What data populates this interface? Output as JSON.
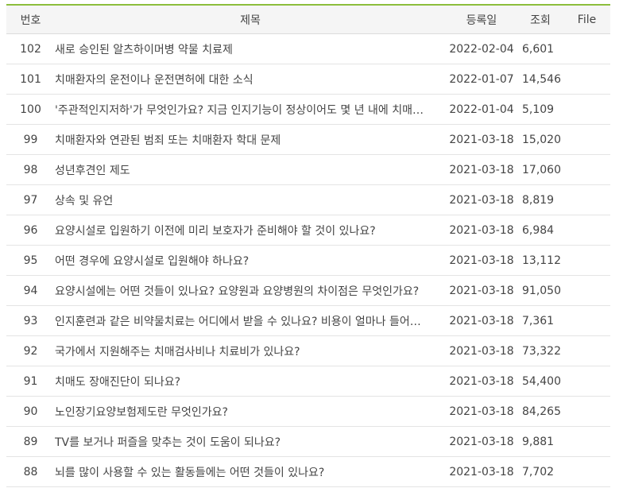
{
  "columns": {
    "number": "번호",
    "title": "제목",
    "date": "등록일",
    "views": "조회",
    "file": "File"
  },
  "rows": [
    {
      "number": "102",
      "title": "새로 승인된 알츠하이머병 약물 치료제",
      "date": "2022-02-04",
      "views": "6,601"
    },
    {
      "number": "101",
      "title": "치매환자의 운전이나 운전면허에 대한 소식",
      "date": "2022-01-07",
      "views": "14,546"
    },
    {
      "number": "100",
      "title": "'주관적인지저하'가 무엇인가요? 지금 인지기능이 정상이어도 몇 년 내에 치매…",
      "date": "2022-01-04",
      "views": "5,109"
    },
    {
      "number": "99",
      "title": "치매환자와 연관된 범죄 또는 치매환자 학대 문제",
      "date": "2021-03-18",
      "views": "15,020"
    },
    {
      "number": "98",
      "title": "성년후견인 제도",
      "date": "2021-03-18",
      "views": "17,060"
    },
    {
      "number": "97",
      "title": "상속 및 유언",
      "date": "2021-03-18",
      "views": "8,819"
    },
    {
      "number": "96",
      "title": "요양시설로 입원하기 이전에 미리 보호자가 준비해야 할 것이 있나요?",
      "date": "2021-03-18",
      "views": "6,984"
    },
    {
      "number": "95",
      "title": "어떤 경우에 요양시설로 입원해야 하나요?",
      "date": "2021-03-18",
      "views": "13,112"
    },
    {
      "number": "94",
      "title": "요양시설에는 어떤 것들이 있나요? 요양원과 요양병원의 차이점은 무엇인가요?",
      "date": "2021-03-18",
      "views": "91,050"
    },
    {
      "number": "93",
      "title": "인지훈련과 같은 비약물치료는 어디에서 받을 수 있나요? 비용이 얼마나 들어…",
      "date": "2021-03-18",
      "views": "7,361"
    },
    {
      "number": "92",
      "title": "국가에서 지원해주는 치매검사비나 치료비가 있나요?",
      "date": "2021-03-18",
      "views": "73,322"
    },
    {
      "number": "91",
      "title": "치매도 장애진단이 되나요?",
      "date": "2021-03-18",
      "views": "54,400"
    },
    {
      "number": "90",
      "title": "노인장기요양보험제도란 무엇인가요?",
      "date": "2021-03-18",
      "views": "84,265"
    },
    {
      "number": "89",
      "title": "TV를 보거나 퍼즐을 맞추는 것이 도움이 되나요?",
      "date": "2021-03-18",
      "views": "9,881"
    },
    {
      "number": "88",
      "title": "뇌를 많이 사용할 수 있는 활동들에는 어떤 것들이 있나요?",
      "date": "2021-03-18",
      "views": "7,702"
    }
  ],
  "colors": {
    "accent": "#8cbe3c",
    "header_bg": "#f5f5f5"
  }
}
